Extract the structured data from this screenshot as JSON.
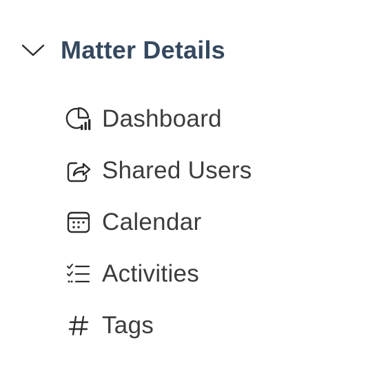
{
  "section": {
    "title": "Matter Details",
    "expanded": true,
    "toggle_icon": "chevron-down-icon",
    "title_color": "#35485f"
  },
  "nav": {
    "items": [
      {
        "label": "Dashboard",
        "icon": "dashboard-chart-icon"
      },
      {
        "label": "Shared Users",
        "icon": "share-icon"
      },
      {
        "label": "Calendar",
        "icon": "calendar-icon"
      },
      {
        "label": "Activities",
        "icon": "checklist-icon"
      },
      {
        "label": "Tags",
        "icon": "hashtag-icon"
      }
    ]
  }
}
